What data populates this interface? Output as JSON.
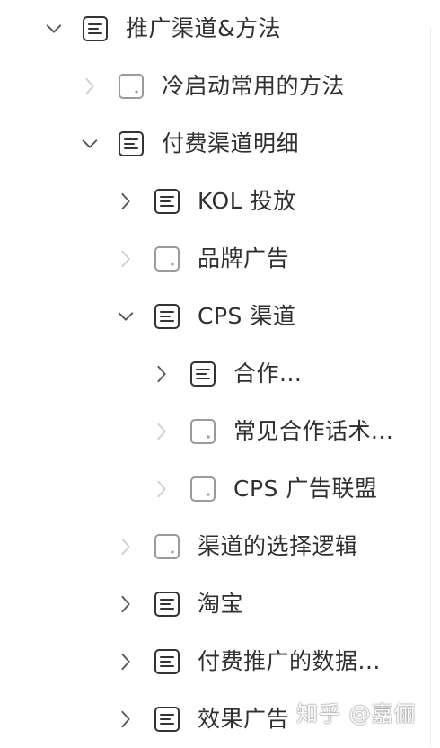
{
  "colors": {
    "text": "#2f2f2f",
    "chevron_strong": "#555555",
    "chevron_light": "#cfcfcf",
    "icon_doc": "#333333",
    "icon_empty": "#9a9a9a"
  },
  "tree": [
    {
      "label": "推广渠道&方法",
      "depth": 0,
      "icon": "doc-lines-icon",
      "chevron": "expanded"
    },
    {
      "label": "冷启动常用的方法",
      "depth": 1,
      "icon": "empty-page-icon",
      "chevron": "collapsed-disabled"
    },
    {
      "label": "付费渠道明细",
      "depth": 1,
      "icon": "doc-lines-icon",
      "chevron": "expanded"
    },
    {
      "label": "KOL 投放",
      "depth": 2,
      "icon": "doc-lines-icon",
      "chevron": "collapsed"
    },
    {
      "label": "品牌广告",
      "depth": 2,
      "icon": "empty-page-icon",
      "chevron": "collapsed-disabled"
    },
    {
      "label": "CPS 渠道",
      "depth": 2,
      "icon": "doc-lines-icon",
      "chevron": "expanded"
    },
    {
      "label": "合作...",
      "depth": 3,
      "icon": "doc-lines-icon",
      "chevron": "collapsed"
    },
    {
      "label": "常见合作话术...",
      "depth": 3,
      "icon": "empty-page-icon",
      "chevron": "collapsed-disabled"
    },
    {
      "label": "CPS 广告联盟",
      "depth": 3,
      "icon": "empty-page-icon",
      "chevron": "collapsed-disabled"
    },
    {
      "label": "渠道的选择逻辑",
      "depth": 2,
      "icon": "empty-page-icon",
      "chevron": "collapsed-disabled"
    },
    {
      "label": "淘宝",
      "depth": 2,
      "icon": "doc-lines-icon",
      "chevron": "collapsed"
    },
    {
      "label": "付费推广的数据...",
      "depth": 2,
      "icon": "doc-lines-icon",
      "chevron": "collapsed"
    },
    {
      "label": "效果广告",
      "depth": 2,
      "icon": "doc-lines-icon",
      "chevron": "collapsed"
    }
  ],
  "watermark": "知乎 @嘉俪"
}
